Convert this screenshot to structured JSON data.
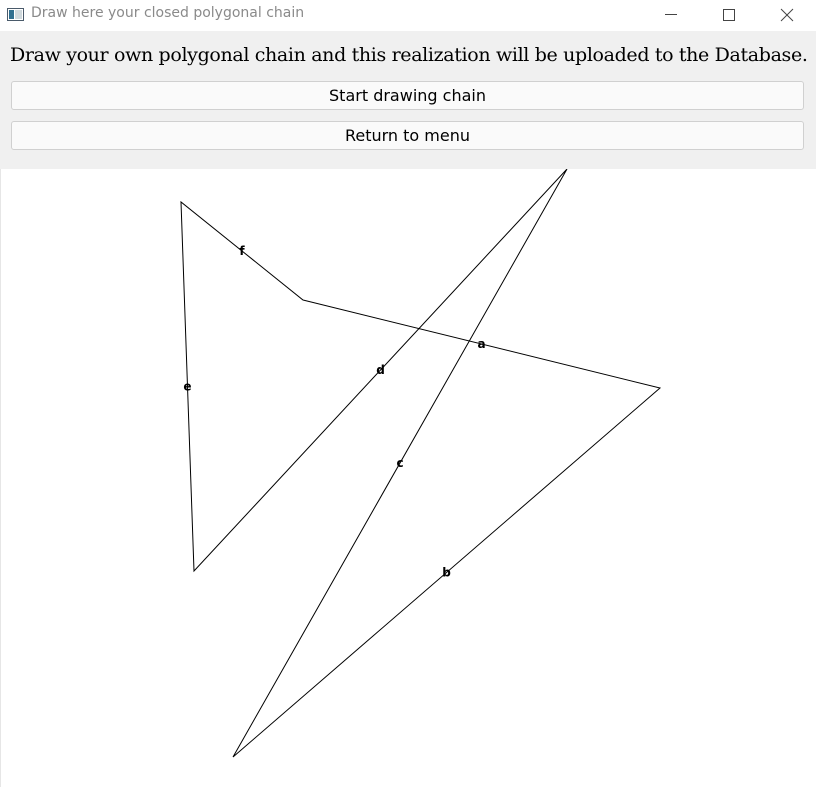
{
  "window": {
    "title": "Draw here your closed polygonal chain",
    "icons": {
      "app": "app-window-icon",
      "minimize": "minimize-icon",
      "maximize": "maximize-icon",
      "close": "close-icon"
    }
  },
  "panel": {
    "instruction": "Draw your own polygonal chain and this realization will be uploaded to the Database.",
    "start_button": "Start drawing chain",
    "return_button": "Return to menu"
  },
  "canvas": {
    "edges": [
      {
        "label": "a",
        "from": 0,
        "to": 1
      },
      {
        "label": "b",
        "from": 1,
        "to": 2
      },
      {
        "label": "c",
        "from": 2,
        "to": 3
      },
      {
        "label": "d",
        "from": 3,
        "to": 4
      },
      {
        "label": "e",
        "from": 4,
        "to": 5
      },
      {
        "label": "f",
        "from": 5,
        "to": 0
      }
    ],
    "line_color": "#000000"
  }
}
